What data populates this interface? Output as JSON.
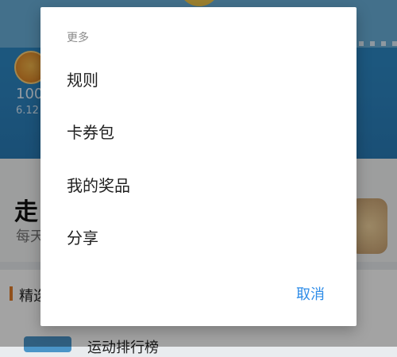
{
  "background": {
    "step_count_partial": "100",
    "sub_partial": "6.12",
    "walk_partial": "走",
    "daily_partial": "每天",
    "section_partial": "精选",
    "rank_partial": "运动排行榜"
  },
  "dialog": {
    "title": "更多",
    "items": [
      {
        "label": "规则"
      },
      {
        "label": "卡券包"
      },
      {
        "label": "我的奖品"
      },
      {
        "label": "分享"
      }
    ],
    "cancel_label": "取消"
  },
  "colors": {
    "accent": "#2d8ce8",
    "dialog_bg": "#ffffff",
    "title_text": "#8a8a8a",
    "item_text": "#212121"
  }
}
